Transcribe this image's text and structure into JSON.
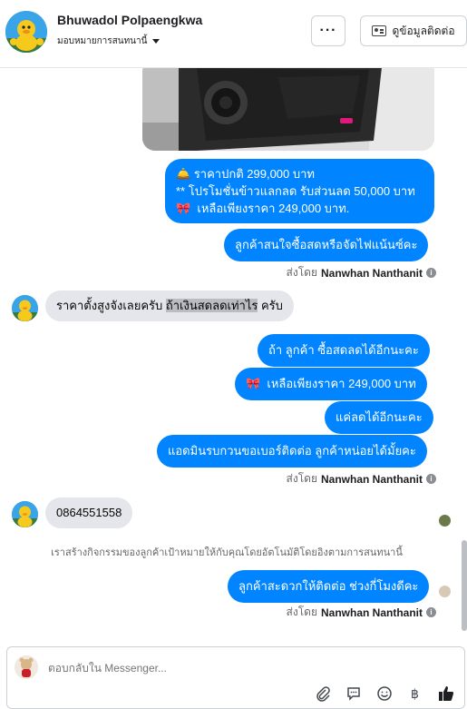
{
  "header": {
    "name": "Bhuwadol Polpaengkwa",
    "subtitle": "มอบหมายการสนทนานี้",
    "more_label": "···",
    "contact_label": "ดูข้อมูลติดต่อ"
  },
  "messages": {
    "price_line1": "ราคาปกติ  299,000 บาท",
    "price_line2": "** โปรโมชั่นข้าวแลกลด รับส่วนลด 50,000 บาท",
    "price_line3": "เหลือเพียงราคา 249,000 บาท.",
    "ask_pay": "ลูกค้าสนใจซื้อสดหรือจัดไฟแน้นซ์คะ",
    "cust_msg1_a": "ราคาตั้งสูงจังเลยครับ ",
    "cust_msg1_b": "ถ้าเงินสดลดเท่าไร",
    "cust_msg1_c": " ครับ",
    "reply1": "ถ้า ลูกค้า ซื้อสดลดได้อีกนะคะ",
    "reply2": "เหลือเพียงราคา 249,000 บาท",
    "reply3": "แค่ลดได้อีกนะคะ",
    "reply4": "แอดมินรบกวนขอเบอร์ติดต่อ ลูกค้าหน่อยได้มั้ยคะ",
    "cust_phone": "0864551558",
    "system_note": "เราสร้างกิจกรรมของลูกค้าเป้าหมายให้กับคุณโดยอัตโนมัติโดยอิงตามการสนทนานี้",
    "reply5": "ลูกค้าสะดวกให้ติดต่อ ช่วงกี่โมงดีคะ"
  },
  "sent_by": {
    "prefix": "ส่งโดย",
    "agent": "Nanwhan Nanthanit"
  },
  "composer": {
    "placeholder": "ตอบกลับใน Messenger..."
  },
  "icons": {
    "bell": "bell-emoji",
    "ribbon": "ribbon-emoji"
  },
  "colors": {
    "accent": "#0084ff",
    "incoming_bubble": "#e4e6eb"
  }
}
